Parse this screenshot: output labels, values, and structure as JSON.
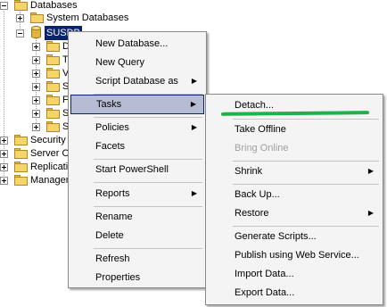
{
  "tree": {
    "databases": "Databases",
    "system_databases": "System Databases",
    "selected_db": "SUSDB",
    "child_initials": [
      "D",
      "T",
      "V",
      "S",
      "F",
      "S",
      "S"
    ],
    "security": "Security",
    "server_objects": "Server O",
    "replication": "Replicatio",
    "management": "Managem"
  },
  "context_menu": {
    "items": [
      {
        "label": "New Database...",
        "submenu": false
      },
      {
        "label": "New Query",
        "submenu": false
      },
      {
        "label": "Script Database as",
        "submenu": true
      },
      {
        "label": "Tasks",
        "submenu": true,
        "highlighted": true
      },
      {
        "label": "Policies",
        "submenu": true
      },
      {
        "label": "Facets",
        "submenu": false
      },
      {
        "label": "Start PowerShell",
        "submenu": false
      },
      {
        "label": "Reports",
        "submenu": true
      },
      {
        "label": "Rename",
        "submenu": false
      },
      {
        "label": "Delete",
        "submenu": false
      },
      {
        "label": "Refresh",
        "submenu": false
      },
      {
        "label": "Properties",
        "submenu": false
      }
    ],
    "submenu_arrow": "▶"
  },
  "tasks_submenu": {
    "items": [
      {
        "label": "Detach...",
        "submenu": false
      },
      {
        "label": "Take Offline",
        "submenu": false
      },
      {
        "label": "Bring Online",
        "submenu": false,
        "disabled": true
      },
      {
        "label": "Shrink",
        "submenu": true
      },
      {
        "label": "Back Up...",
        "submenu": false
      },
      {
        "label": "Restore",
        "submenu": true
      },
      {
        "label": "Generate Scripts...",
        "submenu": false
      },
      {
        "label": "Publish using Web Service...",
        "submenu": false
      },
      {
        "label": "Import Data...",
        "submenu": false
      },
      {
        "label": "Export Data...",
        "submenu": false
      }
    ]
  },
  "colors": {
    "highlight_bg": "#b6bdd2",
    "highlight_border": "#0a246a",
    "annotation_underline": "#1fb24a",
    "selection_bg": "#0a246a"
  }
}
